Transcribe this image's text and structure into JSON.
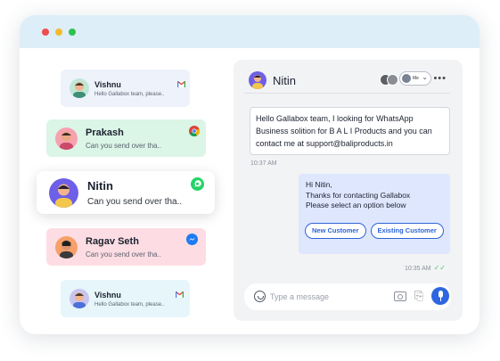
{
  "window": {
    "controls": [
      "close",
      "minimize",
      "maximize"
    ],
    "colors": {
      "close": "#ef4d4d",
      "minimize": "#f5b82e",
      "maximize": "#2ec24f",
      "titlebar": "#ddeef8"
    }
  },
  "contacts": [
    {
      "name": "Vishnu",
      "snippet": "Hello Gallabox team, please..",
      "channel": "gmail-icon",
      "background": "#eef2fb"
    },
    {
      "name": "Prakash",
      "snippet": "Can you send over tha..",
      "channel": "chrome-icon",
      "background": "#dbf5e6"
    },
    {
      "name": "Nitin",
      "snippet": "Can you send over tha..",
      "channel": "whatsapp-icon",
      "background": "#ffffff",
      "active": true
    },
    {
      "name": "Ragav Seth",
      "snippet": "Can you send over tha..",
      "channel": "messenger-icon",
      "background": "#fddde3"
    },
    {
      "name": "Vishnu",
      "snippet": "Hello Gallabox team, please..",
      "channel": "gmail-icon",
      "background": "#e6f6fb"
    }
  ],
  "chat": {
    "contact_name": "Nitin",
    "assignee_label": "Me",
    "incoming": {
      "lines": [
        "Hello Gallabox team, I looking for WhatsApp",
        "Business solition for B A L I Products and you can",
        "contact me at support@baliproducts.in"
      ],
      "time": "10:37 AM"
    },
    "outgoing": {
      "lines": [
        "Hi Nitin,",
        "Thanks for contacting Gallabox",
        "Please select an option below"
      ],
      "buttons": [
        "New Customer",
        "Existing Customer"
      ],
      "time": "10:35 AM"
    },
    "composer": {
      "placeholder": "Type a message"
    },
    "accent": "#2f66e0"
  }
}
